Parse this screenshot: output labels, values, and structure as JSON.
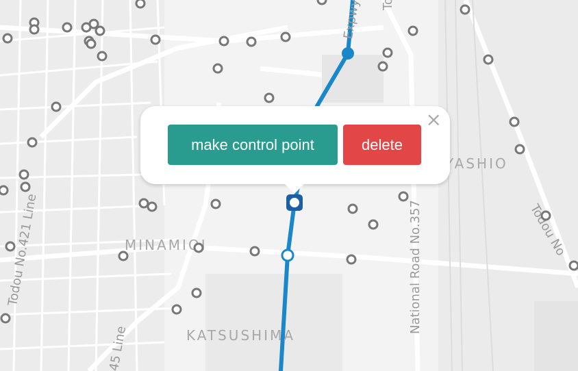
{
  "map": {
    "areas": {
      "minamioi": "MINAMIOI",
      "katsushima": "KATSUSHIMA",
      "yashio": "YASHIO"
    },
    "roads": {
      "todou_427": "Todou No.421 Line",
      "national_357": "National Road No.357",
      "todou_right": "Todou No",
      "line_45": "45 Line",
      "expwy": "Expwy",
      "top_to": "To"
    },
    "colors": {
      "route": "#1a87c9",
      "stop_stroke": "#777777",
      "control_button": "#2a9b8f",
      "delete_button": "#e34646"
    }
  },
  "popup": {
    "make_control_point_label": "make control point",
    "delete_label": "delete",
    "close_symbol": "×"
  }
}
